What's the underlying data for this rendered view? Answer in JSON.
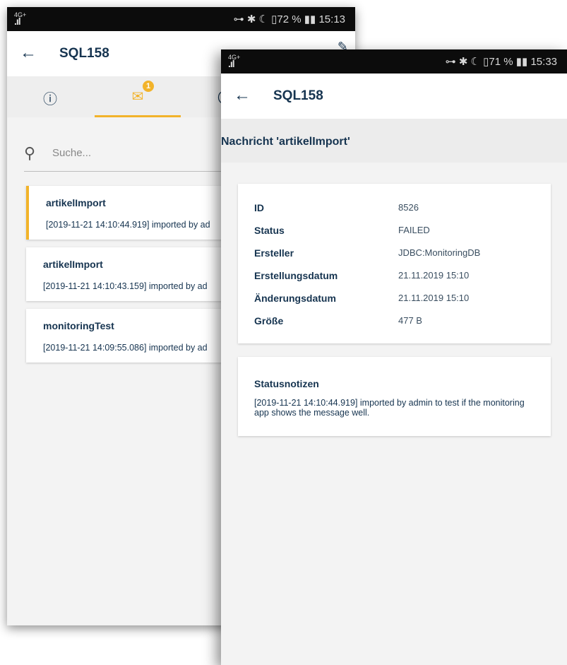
{
  "back_screen": {
    "statusbar": {
      "signal": "4G+",
      "right": "⊶ ✱ ☾ ▯72 % ▮▮ 15:13"
    },
    "appbar": {
      "title": "SQL158"
    },
    "tabs": [
      {
        "name": "info",
        "icon": "ⓘ"
      },
      {
        "name": "messages",
        "icon": "✉",
        "badge": "1"
      }
    ],
    "search": {
      "placeholder": "Suche..."
    },
    "messages": [
      {
        "title": "artikelImport",
        "detail": "[2019-11-21 14:10:44.919] imported by ad"
      },
      {
        "title": "artikelImport",
        "detail": "[2019-11-21 14:10:43.159] imported by ad"
      },
      {
        "title": "monitoringTest",
        "detail": "[2019-11-21 14:09:55.086] imported by ad"
      }
    ]
  },
  "front_screen": {
    "statusbar": {
      "signal": "4G+",
      "right": "⊶ ✱ ☾ ▯71 % ▮▮ 15:33"
    },
    "appbar": {
      "title": "SQL158"
    },
    "subheader": "Nachricht 'artikelImport'",
    "details": [
      {
        "key": "ID",
        "value": "8526"
      },
      {
        "key": "Status",
        "value": "FAILED"
      },
      {
        "key": "Ersteller",
        "value": "JDBC:MonitoringDB"
      },
      {
        "key": "Erstellungsdatum",
        "value": "21.11.2019 15:10"
      },
      {
        "key": "Änderungsdatum",
        "value": "21.11.2019 15:10"
      },
      {
        "key": "Größe",
        "value": "477 B"
      }
    ],
    "notes": {
      "title": "Statusnotizen",
      "text": "[2019-11-21 14:10:44.919] imported by admin to test if the monitoring app shows the message well."
    }
  }
}
